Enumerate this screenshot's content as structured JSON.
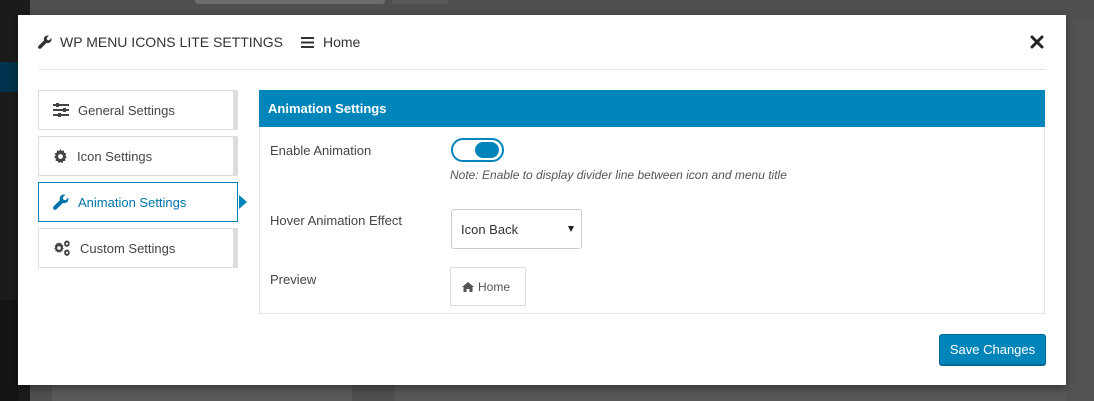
{
  "header": {
    "title": "WP MENU ICONS LITE SETTINGS",
    "home": "Home"
  },
  "sidebar": {
    "items": [
      {
        "label": "General Settings",
        "icon": "sliders-icon",
        "active": false
      },
      {
        "label": "Icon Settings",
        "icon": "gear-icon",
        "active": false
      },
      {
        "label": "Animation Settings",
        "icon": "wrench-icon",
        "active": true
      },
      {
        "label": "Custom Settings",
        "icon": "gears-icon",
        "active": false
      }
    ]
  },
  "panel": {
    "title": "Animation Settings",
    "enable_animation": {
      "label": "Enable Animation",
      "value": true,
      "note": "Note: Enable to display divider line between icon and menu title"
    },
    "hover_effect": {
      "label": "Hover Animation Effect",
      "selected": "Icon Back"
    },
    "preview": {
      "label": "Preview",
      "text": "Home",
      "icon": "home-icon"
    }
  },
  "footer": {
    "save_label": "Save Changes"
  },
  "colors": {
    "accent": "#0085ba",
    "overlay": "#4f4f4f"
  }
}
